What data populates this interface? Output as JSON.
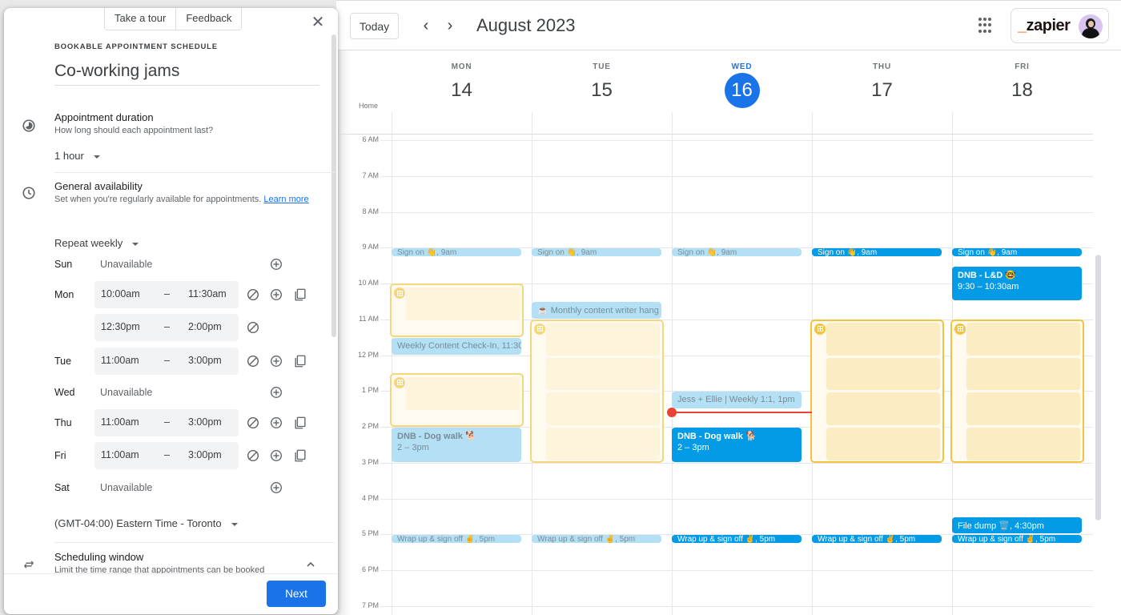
{
  "panel": {
    "take_tour": "Take a tour",
    "feedback": "Feedback",
    "kicker": "BOOKABLE APPOINTMENT SCHEDULE",
    "title": "Co-working jams",
    "duration": {
      "title": "Appointment duration",
      "subtitle": "How long should each appointment last?",
      "value": "1 hour"
    },
    "availability": {
      "title": "General availability",
      "subtitle": "Set when you're regularly available for appointments.",
      "learn_more": "Learn more",
      "repeat": "Repeat weekly",
      "dash": "–",
      "days": [
        {
          "day": "Sun",
          "unavailable": "Unavailable"
        },
        {
          "day": "Mon",
          "from": "10:00am",
          "to": "11:30am"
        },
        {
          "day": "",
          "from": "12:30pm",
          "to": "2:00pm"
        },
        {
          "day": "Tue",
          "from": "11:00am",
          "to": "3:00pm"
        },
        {
          "day": "Wed",
          "unavailable": "Unavailable"
        },
        {
          "day": "Thu",
          "from": "11:00am",
          "to": "3:00pm"
        },
        {
          "day": "Fri",
          "from": "11:00am",
          "to": "3:00pm"
        },
        {
          "day": "Sat",
          "unavailable": "Unavailable"
        }
      ],
      "timezone": "(GMT-04:00) Eastern Time - Toronto"
    },
    "scheduling": {
      "title": "Scheduling window",
      "subtitle": "Limit the time range that appointments can be booked"
    },
    "next": "Next"
  },
  "calendar": {
    "today_button": "Today",
    "prev": "‹",
    "next": "›",
    "month": "August 2023",
    "brand": "zapier",
    "tz_label": "Home",
    "days": [
      {
        "name": "MON",
        "num": "14",
        "today": false
      },
      {
        "name": "TUE",
        "num": "15",
        "today": false
      },
      {
        "name": "WED",
        "num": "16",
        "today": true
      },
      {
        "name": "THU",
        "num": "17",
        "today": false
      },
      {
        "name": "FRI",
        "num": "18",
        "today": false
      }
    ],
    "hours": [
      "6 AM",
      "7 AM",
      "8 AM",
      "9 AM",
      "10 AM",
      "11 AM",
      "12 PM",
      "1 PM",
      "2 PM",
      "3 PM",
      "4 PM",
      "5 PM",
      "6 PM",
      "7 PM"
    ],
    "events": [
      {
        "day": 0,
        "start": 9,
        "end": 9.25,
        "title": "Sign on 👋, 9am",
        "state": "past"
      },
      {
        "day": 1,
        "start": 9,
        "end": 9.25,
        "title": "Sign on 👋, 9am",
        "state": "past"
      },
      {
        "day": 2,
        "start": 9,
        "end": 9.25,
        "title": "Sign on 👋, 9am",
        "state": "past"
      },
      {
        "day": 3,
        "start": 9,
        "end": 9.25,
        "title": "Sign on 👋, 9am",
        "state": "now"
      },
      {
        "day": 4,
        "start": 9,
        "end": 9.25,
        "title": "Sign on 👋, 9am",
        "state": "now"
      },
      {
        "day": 4,
        "start": 9.5,
        "end": 10.5,
        "title": "DNB - L&D 🤓",
        "time": "9:30 – 10:30am",
        "state": "now",
        "tall": true
      },
      {
        "day": 1,
        "start": 10.5,
        "end": 11,
        "title": "☕ Monthly content writer hang",
        "state": "past"
      },
      {
        "day": 0,
        "start": 11.5,
        "end": 12,
        "title": "Weekly Content Check-In, 11:30",
        "state": "past"
      },
      {
        "day": 2,
        "start": 13,
        "end": 13.5,
        "title": "Jess + Ellie | Weekly 1:1, 1pm",
        "state": "past"
      },
      {
        "day": 0,
        "start": 14,
        "end": 15,
        "title": "DNB - Dog walk 🐕",
        "time": "2 – 3pm",
        "state": "past",
        "tall": true
      },
      {
        "day": 2,
        "start": 14,
        "end": 15,
        "title": "DNB - Dog walk 🐕",
        "time": "2 – 3pm",
        "state": "now",
        "tall": true
      },
      {
        "day": 4,
        "start": 16.5,
        "end": 17,
        "title": "File dump 🗑️, 4:30pm",
        "state": "now"
      },
      {
        "day": 0,
        "start": 17,
        "end": 17.25,
        "title": "Wrap up & sign off ✌️, 5pm",
        "state": "past"
      },
      {
        "day": 1,
        "start": 17,
        "end": 17.25,
        "title": "Wrap up & sign off ✌️, 5pm",
        "state": "past"
      },
      {
        "day": 2,
        "start": 17,
        "end": 17.25,
        "title": "Wrap up & sign off ✌️, 5pm",
        "state": "now"
      },
      {
        "day": 3,
        "start": 17,
        "end": 17.25,
        "title": "Wrap up & sign off ✌️, 5pm",
        "state": "now"
      },
      {
        "day": 4,
        "start": 17,
        "end": 17.25,
        "title": "Wrap up & sign off ✌️, 5pm",
        "state": "now"
      }
    ],
    "booking_slots": [
      {
        "day": 0,
        "start": 10,
        "end": 11.5,
        "blocks": 1,
        "state": "past"
      },
      {
        "day": 0,
        "start": 12.5,
        "end": 14,
        "blocks": 1,
        "state": "past"
      },
      {
        "day": 1,
        "start": 11,
        "end": 15,
        "blocks": 4,
        "state": "past"
      },
      {
        "day": 3,
        "start": 11,
        "end": 15,
        "blocks": 4,
        "state": "now"
      },
      {
        "day": 4,
        "start": 11,
        "end": 15,
        "blocks": 4,
        "state": "now"
      }
    ],
    "current_time": {
      "day": 2,
      "hour": 13.6
    }
  }
}
